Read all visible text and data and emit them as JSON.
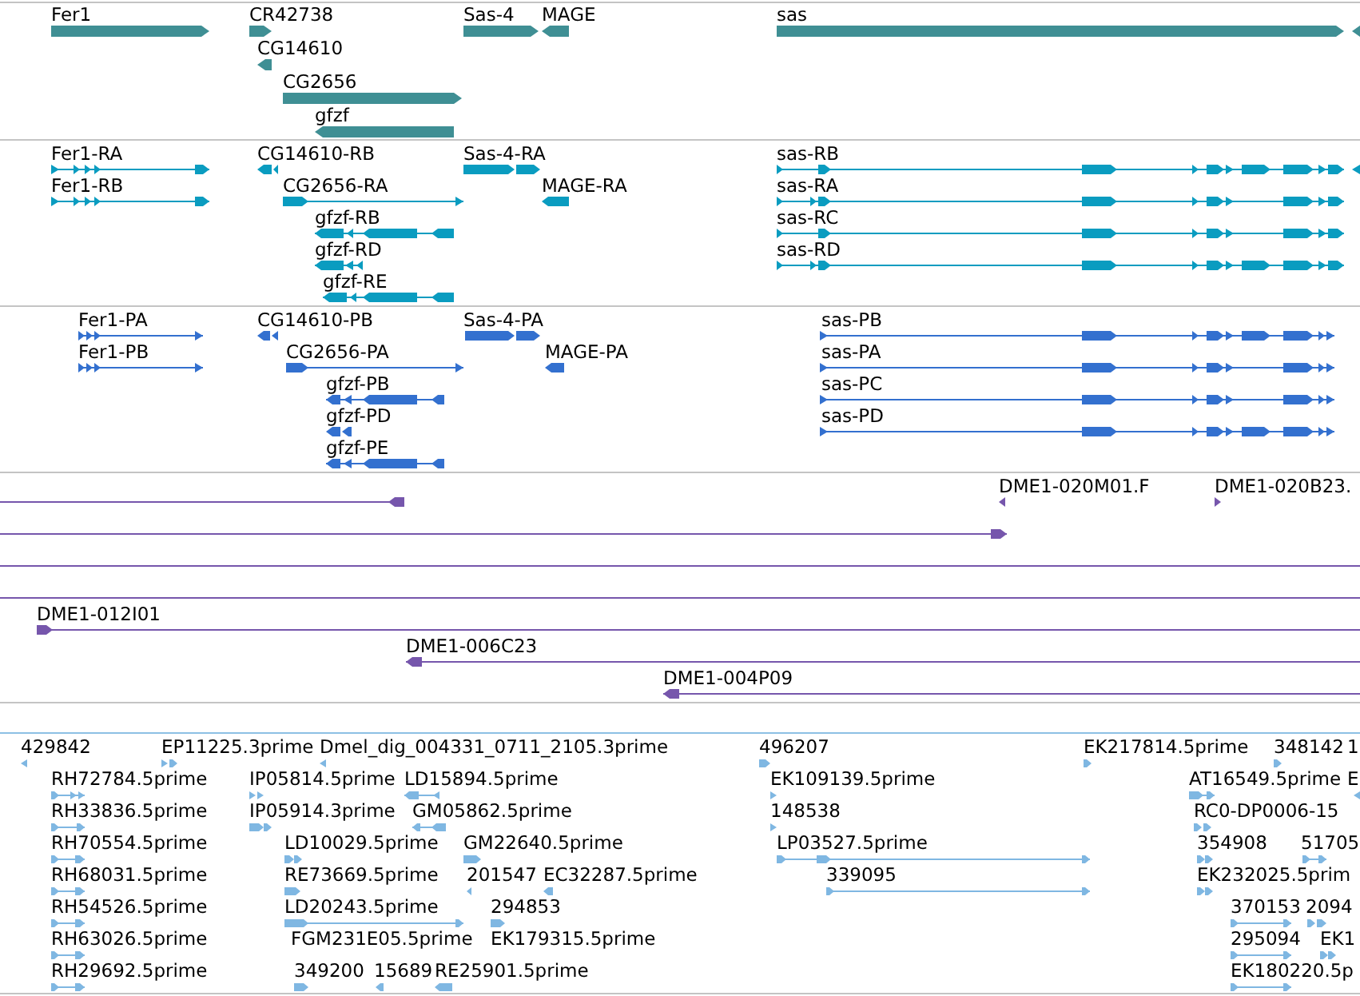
{
  "tracks": [
    {
      "kind": "gene",
      "features": [
        {
          "label": "Fer1",
          "reverse": false
        },
        {
          "label": "CR42738",
          "reverse": false
        },
        {
          "label": "Sas-4",
          "reverse": false
        },
        {
          "label": "MAGE",
          "reverse": true
        },
        {
          "label": "sas",
          "reverse": false
        },
        {
          "reverse": true
        },
        {
          "label": "CG14610",
          "reverse": true
        },
        {
          "label": "CG2656",
          "reverse": false
        },
        {
          "label": "gfzf",
          "reverse": true
        }
      ]
    },
    {
      "kind": "transcript",
      "features": [
        {
          "label": "Fer1-RA",
          "reverse": false
        },
        {
          "label": "CG14610-RB",
          "reverse": true
        },
        {
          "label": "Sas-4-RA",
          "reverse": false
        },
        {
          "label": "sas-RB",
          "reverse": false
        },
        {
          "reverse": true
        },
        {
          "label": "Fer1-RB",
          "reverse": false
        },
        {
          "label": "CG2656-RA",
          "reverse": false
        },
        {
          "label": "MAGE-RA",
          "reverse": true
        },
        {
          "label": "sas-RA",
          "reverse": false
        },
        {
          "label": "gfzf-RB",
          "reverse": true
        },
        {
          "label": "sas-RC",
          "reverse": false
        },
        {
          "label": "gfzf-RD",
          "reverse": true
        },
        {
          "label": "sas-RD",
          "reverse": false
        },
        {
          "label": "gfzf-RE",
          "reverse": true
        }
      ]
    },
    {
      "kind": "protein",
      "features": [
        {
          "label": "Fer1-PA",
          "reverse": false
        },
        {
          "label": "CG14610-PB",
          "reverse": true
        },
        {
          "label": "Sas-4-PA",
          "reverse": false
        },
        {
          "label": "sas-PB",
          "reverse": false
        },
        {
          "label": "Fer1-PB",
          "reverse": false
        },
        {
          "label": "CG2656-PA",
          "reverse": false
        },
        {
          "label": "MAGE-PA",
          "reverse": true
        },
        {
          "label": "sas-PA",
          "reverse": false
        },
        {
          "label": "gfzf-PB",
          "reverse": true
        },
        {
          "label": "sas-PC",
          "reverse": false
        },
        {
          "label": "gfzf-PD",
          "reverse": true
        },
        {
          "label": "sas-PD",
          "reverse": false
        },
        {
          "label": "gfzf-PE",
          "reverse": true
        }
      ]
    },
    {
      "kind": "clone",
      "features": [
        {
          "kind": "line_end",
          "reverse": true
        },
        {
          "kind": "end",
          "label": "DME1-020M01.F",
          "reverse": true
        },
        {
          "kind": "end",
          "label": "DME1-020B23.",
          "reverse": false
        },
        {
          "kind": "line_end",
          "reverse": false
        },
        {
          "kind": "line"
        },
        {
          "kind": "line"
        },
        {
          "kind": "line_end",
          "label": "DME1-012I01",
          "reverse": false
        },
        {
          "kind": "line_end",
          "label": "DME1-006C23",
          "reverse": true
        },
        {
          "kind": "line_end",
          "label": "DME1-004P09",
          "reverse": true
        }
      ]
    },
    {
      "kind": "est",
      "features": [
        {
          "label": "429842",
          "reverse": true
        },
        {
          "label": "EP11225.3prime",
          "reverse": false
        },
        {
          "label": "Dmel_dig_004331_0711_2105.3prime",
          "reverse": true
        },
        {
          "label": "496207",
          "reverse": false
        },
        {
          "label": "EK217814.5prime",
          "reverse": false
        },
        {
          "label": "348142",
          "reverse": false
        },
        {
          "label": "1"
        },
        {
          "label": "RH72784.5prime",
          "reverse": false
        },
        {
          "label": "IP05814.5prime",
          "reverse": false
        },
        {
          "label": "LD15894.5prime",
          "reverse": true
        },
        {
          "label": "EK109139.5prime",
          "reverse": false
        },
        {
          "label": "AT16549.5prime",
          "reverse": false
        },
        {
          "label": "E",
          "reverse": true
        },
        {
          "label": "RH33836.5prime",
          "reverse": false
        },
        {
          "label": "IP05914.3prime",
          "reverse": false
        },
        {
          "label": "GM05862.5prime",
          "reverse": true
        },
        {
          "label": "148538",
          "reverse": false
        },
        {
          "label": "RC0-DP0006-15",
          "reverse": false
        },
        {
          "label": "RH70554.5prime",
          "reverse": false
        },
        {
          "label": "LD10029.5prime",
          "reverse": false
        },
        {
          "label": "GM22640.5prime",
          "reverse": false
        },
        {
          "label": "LP03527.5prime",
          "reverse": false
        },
        {
          "label": "354908",
          "reverse": false
        },
        {
          "label": "51705",
          "reverse": false
        },
        {
          "label": "RH68031.5prime",
          "reverse": false
        },
        {
          "label": "RE73669.5prime",
          "reverse": false
        },
        {
          "label": "201547",
          "reverse": true
        },
        {
          "label": "EC32287.5prime",
          "reverse": true
        },
        {
          "label": "339095",
          "reverse": false
        },
        {
          "label": "EK232025.5prim",
          "reverse": false
        },
        {
          "label": "RH54526.5prime",
          "reverse": false
        },
        {
          "label": "LD20243.5prime",
          "reverse": false
        },
        {
          "label": "294853",
          "reverse": false
        },
        {
          "label": "370153",
          "reverse": false
        },
        {
          "label": "2094",
          "reverse": false
        },
        {
          "label": "RH63026.5prime",
          "reverse": false
        },
        {
          "label": "FGM231E05.5prime"
        },
        {
          "label": "EK179315.5prime"
        },
        {
          "label": "295094",
          "reverse": false
        },
        {
          "label": "EK1",
          "reverse": false
        },
        {
          "label": "RH29692.5prime",
          "reverse": false
        },
        {
          "label": "349200",
          "reverse": false
        },
        {
          "label": "15689",
          "reverse": true
        },
        {
          "label": "RE25901.5prime",
          "reverse": true
        },
        {
          "label": "EK180220.5p",
          "reverse": false
        }
      ]
    }
  ]
}
